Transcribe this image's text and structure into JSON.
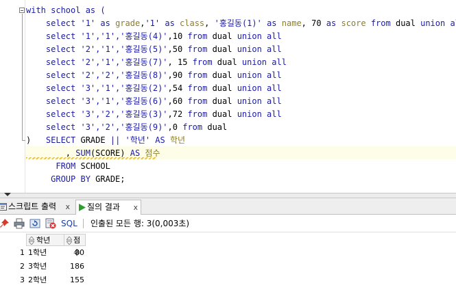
{
  "editor": {
    "lines": [
      [
        [
          "with school as (",
          "kw-plain"
        ]
      ],
      [
        [
          "    select ",
          "kw"
        ],
        [
          "'1'",
          "str"
        ],
        [
          " as ",
          "kw"
        ],
        [
          "grade",
          "olive"
        ],
        [
          ",",
          "plain"
        ],
        [
          "'1'",
          "str"
        ],
        [
          " as ",
          "kw"
        ],
        [
          "class",
          "olive"
        ],
        [
          ", ",
          "plain"
        ],
        [
          "'홍길동(1)'",
          "str"
        ],
        [
          " as ",
          "kw"
        ],
        [
          "name",
          "olive"
        ],
        [
          ", 70 ",
          "plain"
        ],
        [
          "as ",
          "kw"
        ],
        [
          "score",
          "olive"
        ],
        [
          " from ",
          "kw"
        ],
        [
          "dual",
          "plain"
        ],
        [
          " union all",
          "kw"
        ]
      ],
      [
        [
          "    select ",
          "kw"
        ],
        [
          "'1','1','홍길동(4)'",
          "str"
        ],
        [
          ",10 ",
          "plain"
        ],
        [
          "from ",
          "kw"
        ],
        [
          "dual ",
          "plain"
        ],
        [
          "union all",
          "kw"
        ]
      ],
      [
        [
          "    select ",
          "kw"
        ],
        [
          "'2','1','홍길동(5)'",
          "str"
        ],
        [
          ",50 ",
          "plain"
        ],
        [
          "from ",
          "kw"
        ],
        [
          "dual ",
          "plain"
        ],
        [
          "union all",
          "kw"
        ]
      ],
      [
        [
          "    select ",
          "kw"
        ],
        [
          "'2','1','홍길동(7)'",
          "str"
        ],
        [
          ", 15 ",
          "plain"
        ],
        [
          "from ",
          "kw"
        ],
        [
          "dual ",
          "plain"
        ],
        [
          "union all",
          "kw"
        ]
      ],
      [
        [
          "    select ",
          "kw"
        ],
        [
          "'2','2','홍길동(8)'",
          "str"
        ],
        [
          ",90 ",
          "plain"
        ],
        [
          "from ",
          "kw"
        ],
        [
          "dual ",
          "plain"
        ],
        [
          "union all",
          "kw"
        ]
      ],
      [
        [
          "    select ",
          "kw"
        ],
        [
          "'3','1','홍길동(2)'",
          "str"
        ],
        [
          ",54 ",
          "plain"
        ],
        [
          "from ",
          "kw"
        ],
        [
          "dual ",
          "plain"
        ],
        [
          "union all",
          "kw"
        ]
      ],
      [
        [
          "    select ",
          "kw"
        ],
        [
          "'3','1','홍길동(6)'",
          "str"
        ],
        [
          ",60 ",
          "plain"
        ],
        [
          "from ",
          "kw"
        ],
        [
          "dual ",
          "plain"
        ],
        [
          "union all",
          "kw"
        ]
      ],
      [
        [
          "    select ",
          "kw"
        ],
        [
          "'3','2','홍길동(3)'",
          "str"
        ],
        [
          ",72 ",
          "plain"
        ],
        [
          "from ",
          "kw"
        ],
        [
          "dual ",
          "plain"
        ],
        [
          "union all",
          "kw"
        ]
      ],
      [
        [
          "    select ",
          "kw"
        ],
        [
          "'3','2','홍길동(9)'",
          "str"
        ],
        [
          ",0 ",
          "plain"
        ],
        [
          "from ",
          "kw"
        ],
        [
          "dual",
          "plain"
        ]
      ],
      [
        [
          ")   ",
          "plain"
        ],
        [
          "SELECT ",
          "kw"
        ],
        [
          "GRADE ",
          "plain"
        ],
        [
          "|| ",
          "kw"
        ],
        [
          "'학년'",
          "str"
        ],
        [
          " AS ",
          "kw"
        ],
        [
          "학년",
          "olive"
        ]
      ],
      [
        [
          "        , ",
          "plain"
        ],
        [
          "SUM",
          "kw"
        ],
        [
          "(SCORE) ",
          "plain"
        ],
        [
          "AS ",
          "kw"
        ],
        [
          "점수",
          "olive"
        ]
      ],
      [
        [
          "      FROM ",
          "kw"
        ],
        [
          "SCHOOL",
          "plain"
        ]
      ],
      [
        [
          "     GROUP BY ",
          "kw"
        ],
        [
          "GRADE;",
          "plain"
        ]
      ]
    ]
  },
  "tabs": {
    "script_output": "스크립트 출력",
    "query_result": "질의 결과",
    "close_glyph": "x"
  },
  "toolbar": {
    "sql_label": "SQL",
    "status": "인출된 모든 행: 3(0,003초)"
  },
  "grid": {
    "columns": [
      "학년",
      "점수"
    ],
    "rows": [
      {
        "num": "1",
        "grade": "1학년",
        "score": "80"
      },
      {
        "num": "2",
        "grade": "3학년",
        "score": "186"
      },
      {
        "num": "3",
        "grade": "2학년",
        "score": "155"
      }
    ]
  },
  "colors": {
    "keyword": "#1a1aa6",
    "identifier": "#8b7d28",
    "current_line": "#fdfde8",
    "run_green": "#2e9e2e"
  }
}
